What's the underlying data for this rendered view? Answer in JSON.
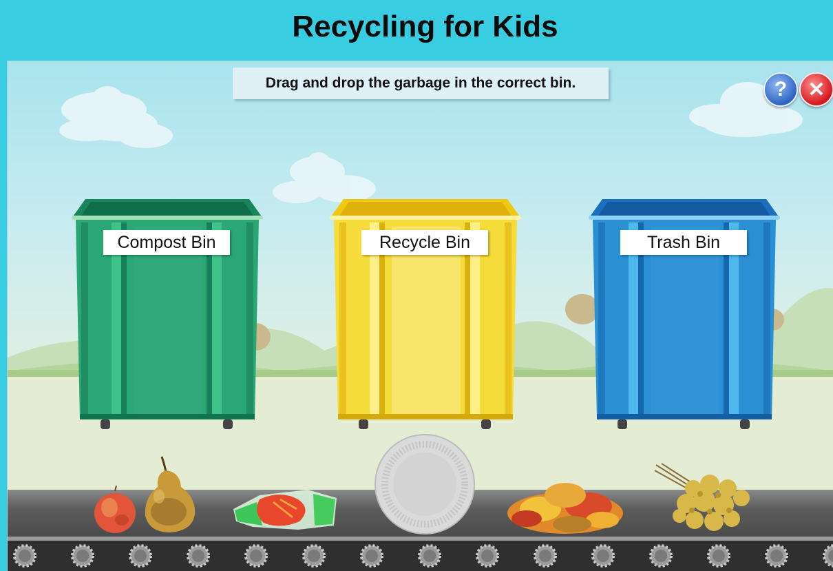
{
  "app": {
    "title": "Recycling for Kids"
  },
  "game": {
    "instruction": "Drag and drop the garbage in the correct bin.",
    "help_icon_glyph": "?",
    "close_icon_glyph": "✕"
  },
  "bins": [
    {
      "label": "Compost Bin",
      "color": "#2aa774"
    },
    {
      "label": "Recycle Bin",
      "color": "#f6dc3a"
    },
    {
      "label": "Trash Bin",
      "color": "#2b8fd4"
    }
  ],
  "items": [
    {
      "name": "apple",
      "icon": "apple-icon"
    },
    {
      "name": "pear",
      "icon": "pear-icon"
    },
    {
      "name": "plastic-wrapper",
      "icon": "plastic-wrapper-icon"
    },
    {
      "name": "paper-plate",
      "icon": "paper-plate-icon"
    },
    {
      "name": "dry-leaves",
      "icon": "leaves-icon"
    },
    {
      "name": "dried-flowers",
      "icon": "dried-flowers-icon"
    }
  ],
  "colors": {
    "header": "#38cde0",
    "compost": "#2aa774",
    "recycle": "#f6dc3a",
    "trash": "#2b8fd4",
    "conveyor": "#5c5c5c"
  }
}
